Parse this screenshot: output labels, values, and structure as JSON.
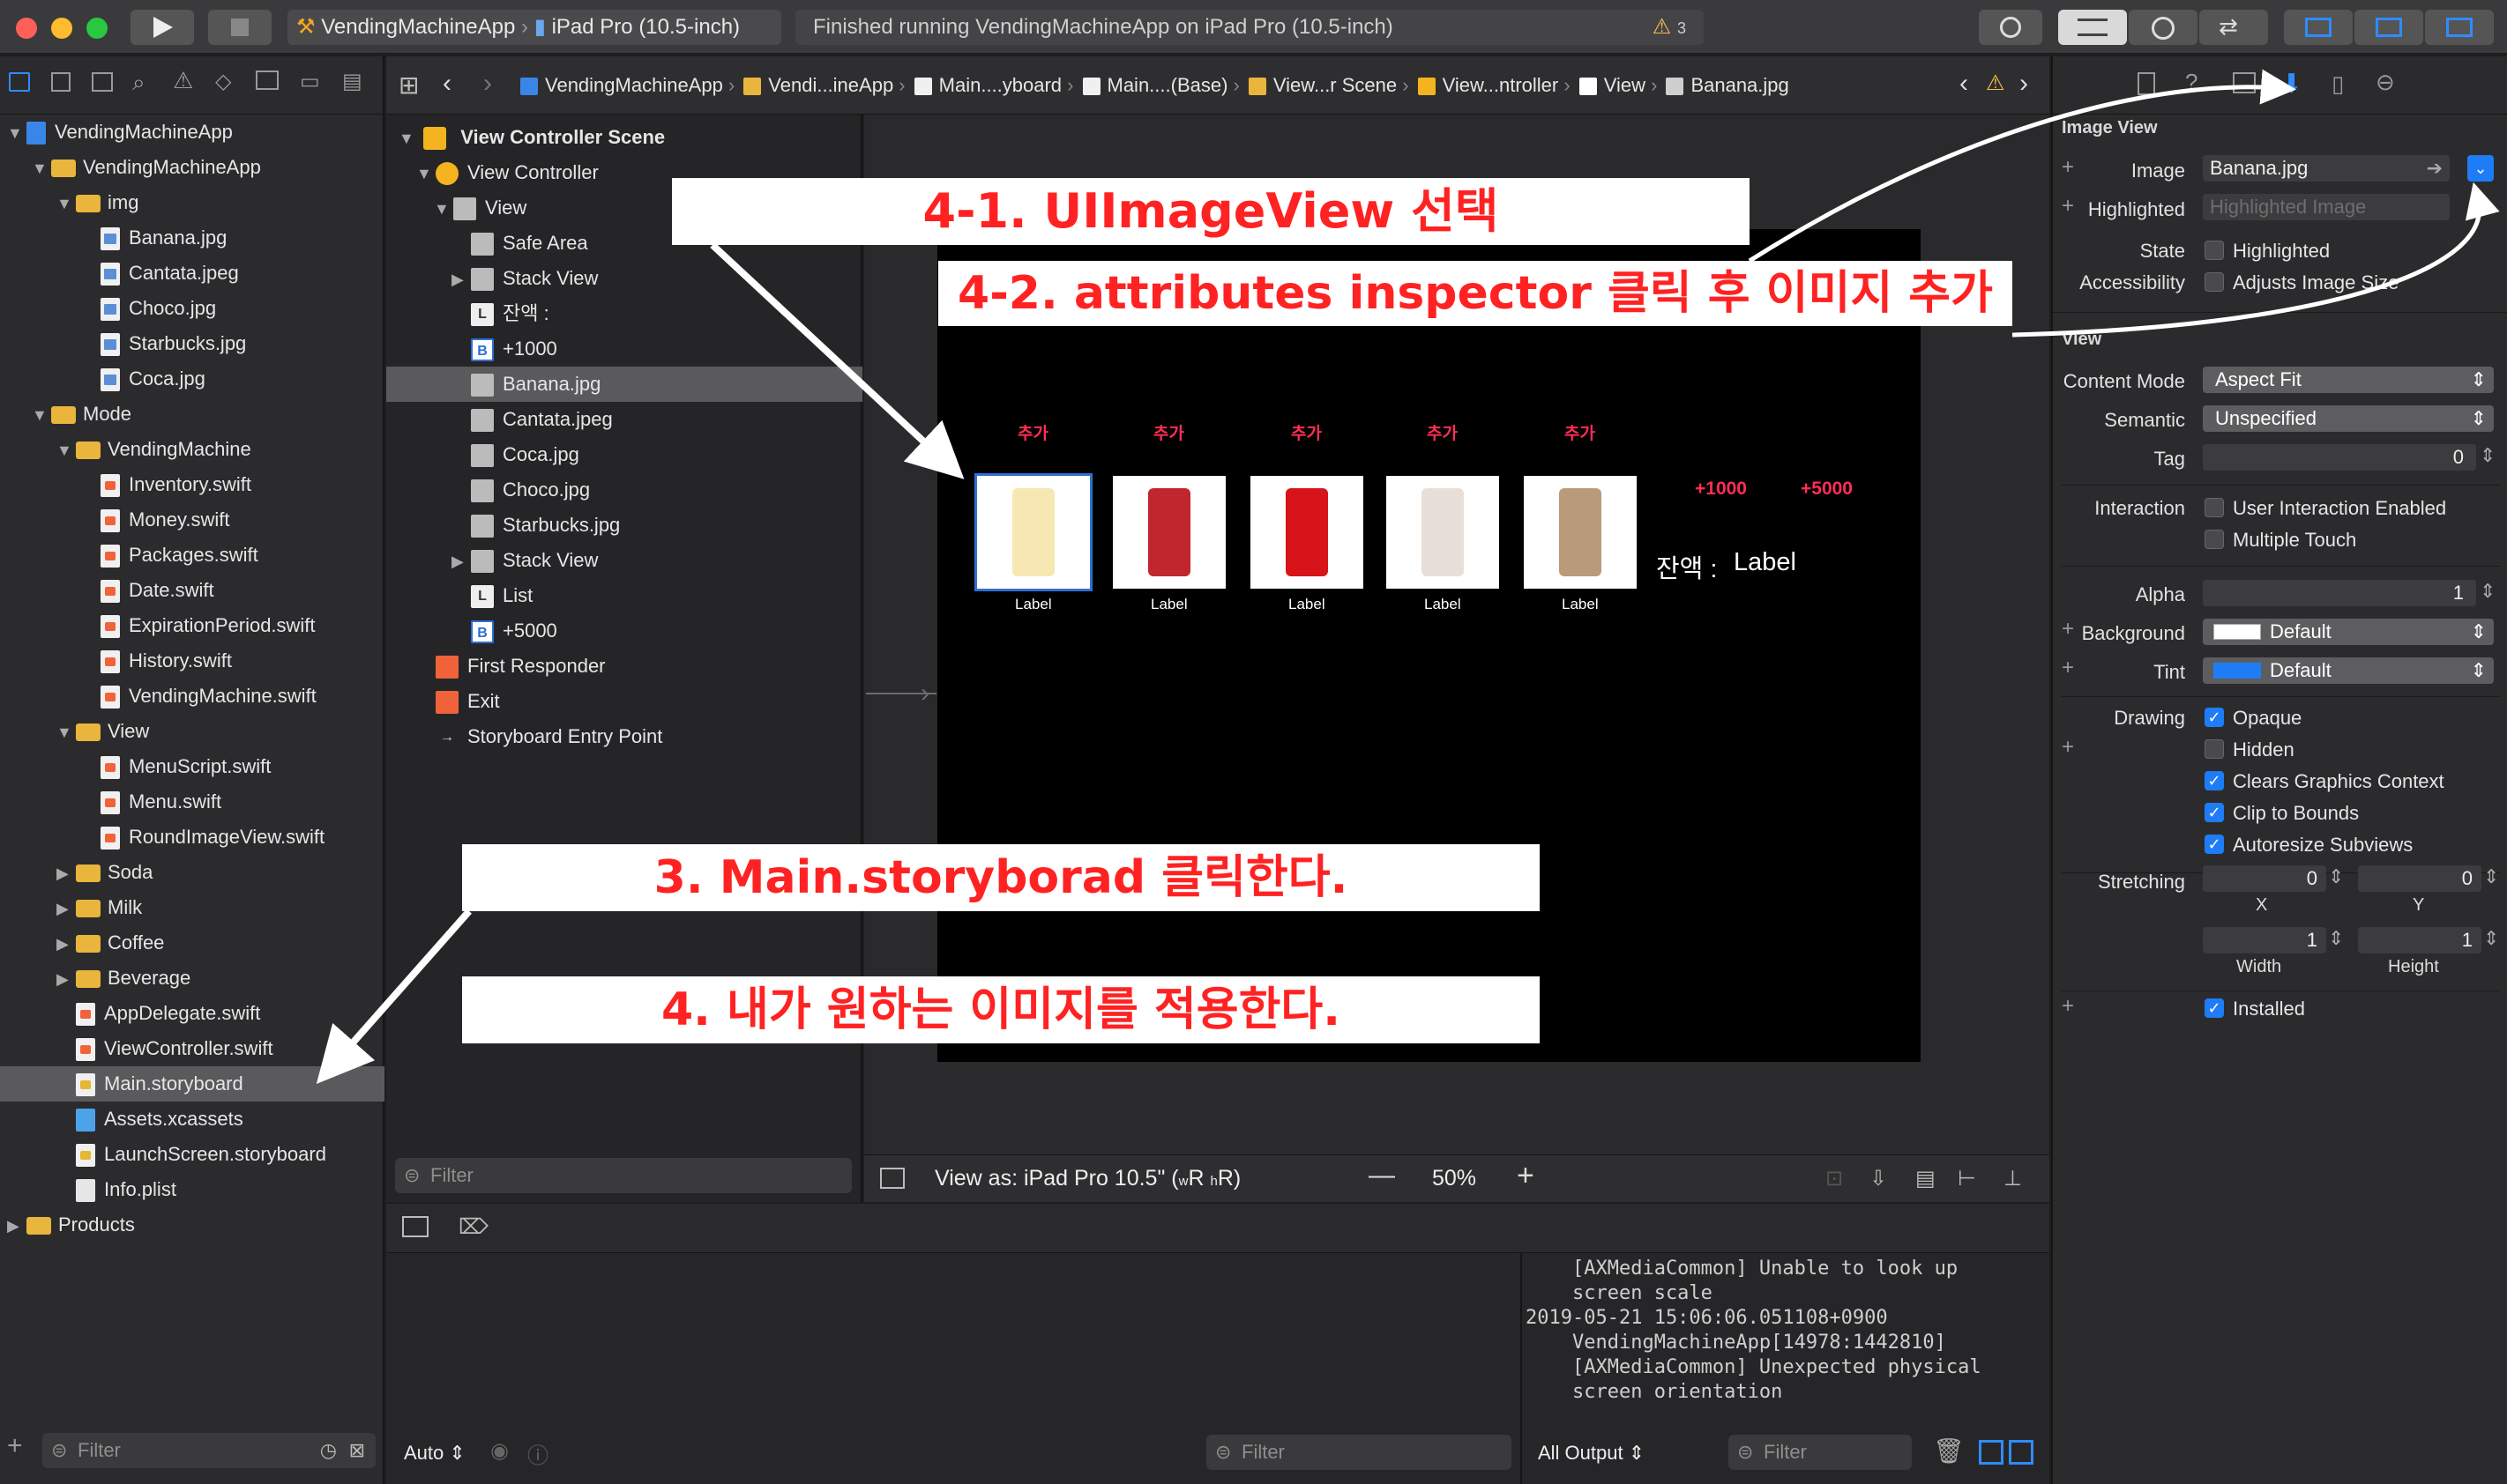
{
  "toolbar": {
    "scheme": "VendingMachineApp",
    "device": "iPad Pro (10.5-inch)",
    "status": "Finished running VendingMachineApp on iPad Pro (10.5-inch)",
    "warning_count": "3"
  },
  "jumpbar": {
    "items": [
      "VendingMachineApp",
      "Vendi...ineApp",
      "Main....yboard",
      "Main....(Base)",
      "View...r Scene",
      "View...ntroller",
      "View",
      "Banana.jpg"
    ]
  },
  "navigator": {
    "items": [
      {
        "label": "VendingMachineApp",
        "kind": "project"
      },
      {
        "label": "VendingMachineApp",
        "kind": "folder"
      },
      {
        "label": "img",
        "kind": "folder"
      },
      {
        "label": "Banana.jpg",
        "kind": "img"
      },
      {
        "label": "Cantata.jpeg",
        "kind": "img"
      },
      {
        "label": "Choco.jpg",
        "kind": "img"
      },
      {
        "label": "Starbucks.jpg",
        "kind": "img"
      },
      {
        "label": "Coca.jpg",
        "kind": "img"
      },
      {
        "label": "Mode",
        "kind": "folder"
      },
      {
        "label": "VendingMachine",
        "kind": "folder"
      },
      {
        "label": "Inventory.swift",
        "kind": "swift"
      },
      {
        "label": "Money.swift",
        "kind": "swift"
      },
      {
        "label": "Packages.swift",
        "kind": "swift"
      },
      {
        "label": "Date.swift",
        "kind": "swift"
      },
      {
        "label": "ExpirationPeriod.swift",
        "kind": "swift"
      },
      {
        "label": "History.swift",
        "kind": "swift"
      },
      {
        "label": "VendingMachine.swift",
        "kind": "swift"
      },
      {
        "label": "View",
        "kind": "folder"
      },
      {
        "label": "MenuScript.swift",
        "kind": "swift"
      },
      {
        "label": "Menu.swift",
        "kind": "swift"
      },
      {
        "label": "RoundImageView.swift",
        "kind": "swift"
      },
      {
        "label": "Soda",
        "kind": "folder"
      },
      {
        "label": "Milk",
        "kind": "folder"
      },
      {
        "label": "Coffee",
        "kind": "folder"
      },
      {
        "label": "Beverage",
        "kind": "folder"
      },
      {
        "label": "AppDelegate.swift",
        "kind": "swift"
      },
      {
        "label": "ViewController.swift",
        "kind": "swift"
      },
      {
        "label": "Main.storyboard",
        "kind": "storyboard"
      },
      {
        "label": "Assets.xcassets",
        "kind": "assets"
      },
      {
        "label": "LaunchScreen.storyboard",
        "kind": "storyboard"
      },
      {
        "label": "Info.plist",
        "kind": "plist"
      },
      {
        "label": "Products",
        "kind": "folder"
      }
    ],
    "filter_placeholder": "Filter"
  },
  "outline": {
    "scene": "View Controller Scene",
    "items": [
      "View Controller",
      "View",
      "Safe Area",
      "Stack View",
      "잔액 :",
      "+1000",
      "Banana.jpg",
      "Cantata.jpeg",
      "Coca.jpg",
      "Choco.jpg",
      "Starbucks.jpg",
      "Stack View",
      "List",
      "+5000",
      "First Responder",
      "Exit",
      "Storyboard Entry Point"
    ],
    "icons": [
      "L",
      "B"
    ],
    "filter_placeholder": "Filter"
  },
  "canvas": {
    "add_label": "추가",
    "product_label": "Label",
    "plus1000": "+1000",
    "plus5000": "+5000",
    "balance": "잔액 :",
    "balance_value": "Label",
    "view_as": "View as: iPad Pro 10.5\" (",
    "size_class_w": "w",
    "size_class_w2": "R",
    "size_class_h": "h",
    "size_class_h2": "R)",
    "zoom": "50%"
  },
  "annotations": {
    "a41": "4-1. UIImageView 선택",
    "a42": "4-2. attributes inspector 클릭 후 이미지 추가",
    "a3": "3. Main.storyborad 클릭한다.",
    "a4": "4. 내가 원하는 이미지를 적용한다."
  },
  "inspector": {
    "image_view_title": "Image View",
    "image_label": "Image",
    "image_value": "Banana.jpg",
    "highlighted_label": "Highlighted",
    "highlighted_placeholder": "Highlighted Image",
    "state_label": "State",
    "state_check": "Highlighted",
    "accessibility_label": "Accessibility",
    "accessibility_check": "Adjusts Image Size",
    "view_title": "View",
    "content_mode_label": "Content Mode",
    "content_mode": "Aspect Fit",
    "semantic_label": "Semantic",
    "semantic": "Unspecified",
    "tag_label": "Tag",
    "tag": "0",
    "interaction_label": "Interaction",
    "uie": "User Interaction Enabled",
    "mt": "Multiple Touch",
    "alpha_label": "Alpha",
    "alpha": "1",
    "background_label": "Background",
    "background": "Default",
    "tint_label": "Tint",
    "tint": "Default",
    "drawing_label": "Drawing",
    "opaque": "Opaque",
    "hidden": "Hidden",
    "clears": "Clears Graphics Context",
    "clip": "Clip to Bounds",
    "autoresize": "Autoresize Subviews",
    "stretching_label": "Stretching",
    "sx": "0",
    "sy": "0",
    "x_label": "X",
    "y_label": "Y",
    "sw": "1",
    "sh": "1",
    "width_label": "Width",
    "height_label": "Height",
    "installed": "Installed"
  },
  "debug": {
    "auto": "Auto",
    "filter_placeholder": "Filter",
    "all_output": "All Output",
    "console_lines": [
      "    [AXMediaCommon] Unable to look up",
      "    screen scale",
      "2019-05-21 15:06:06.051108+0900",
      "    VendingMachineApp[14978:1442810]",
      "    [AXMediaCommon] Unexpected physical",
      "    screen orientation"
    ]
  },
  "colors": {
    "accent": "#1f7cf7",
    "annotation_text": "#ff2222",
    "add_text": "#ff2d55"
  }
}
